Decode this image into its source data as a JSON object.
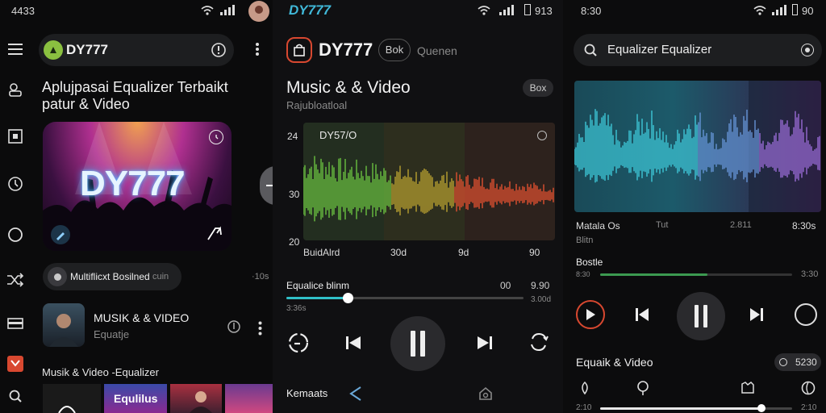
{
  "colors": {
    "accent": "#30c0c8",
    "red": "#d84830",
    "green": "#7ac242",
    "bg": "#0b0b0c"
  },
  "panel1": {
    "status_time": "4433",
    "app_name": "DY777",
    "headline": "Aplujpasai Equalizer Terbaikt patur & Video",
    "hero_text": "DY777",
    "chip_label": "Multiflicxt Bosilned",
    "chip_suffix": "cuin",
    "chip_trailing": "·10s",
    "item_title": "MUSIK & & VIDEO",
    "item_subtitle": "Equatje",
    "section_label": "Musik & Video -Equalizer",
    "thumb_caption": "Equlilus",
    "icons": [
      "menu-icon",
      "scan-icon",
      "square-icon",
      "clock-icon",
      "circle-icon",
      "shuffle-icon",
      "card-icon",
      "app-icon",
      "search-icon"
    ]
  },
  "panel2": {
    "brand": "DY777",
    "status_time": "913",
    "title": "DY777",
    "pill_label": "Bok",
    "tab_label": "Quenen",
    "section_title": "Music & & Video",
    "section_subtitle": "Rajubloatloal",
    "badge_label": "Box",
    "graph_label": "DY57/O",
    "y_ticks": [
      "24",
      "30",
      "20"
    ],
    "x_ticks": [
      "BuidAlrd",
      "30d",
      "9d",
      "90"
    ],
    "track_label": "Equalice blinm",
    "track_time_a": "00",
    "track_time_b": "9.90",
    "elapsed": "3:36s",
    "remaining": "3.00d",
    "progress": 0.26,
    "footer_label": "Kemaats"
  },
  "panel3": {
    "status_time": "8:30",
    "status_right": "90",
    "search_text": "Equalizer Equalizer",
    "labels_row": [
      "Matala Os",
      "Tut",
      "2.811",
      "8:30s"
    ],
    "sub_label": "Blitn",
    "preset_label": "Bostle",
    "small_text": "8:30",
    "progress_time": "3:30",
    "progress": 0.56,
    "section_title": "Equaik & Video",
    "pill_value": "5230",
    "bottom_left": "2:10",
    "bottom_right": "2:10",
    "slider_value": 0.84
  }
}
